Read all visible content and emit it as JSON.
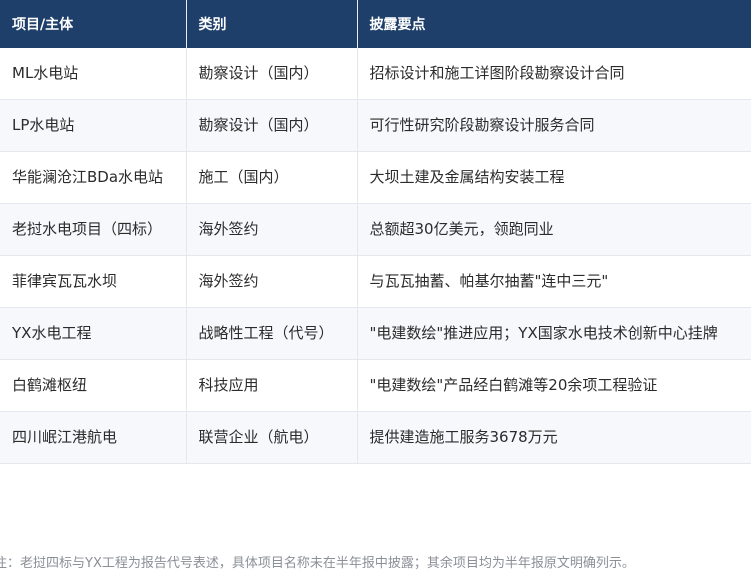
{
  "table": {
    "headers": [
      "项目/主体",
      "类别",
      "披露要点"
    ],
    "rows": [
      [
        "ML水电站",
        "勘察设计（国内）",
        "招标设计和施工详图阶段勘察设计合同"
      ],
      [
        "LP水电站",
        "勘察设计（国内）",
        "可行性研究阶段勘察设计服务合同"
      ],
      [
        "华能澜沧江BDa水电站",
        "施工（国内）",
        "大坝土建及金属结构安装工程"
      ],
      [
        "老挝水电项目（四标）",
        "海外签约",
        "总额超30亿美元，领跑同业"
      ],
      [
        "菲律宾瓦瓦水坝",
        "海外签约",
        "与瓦瓦抽蓄、帕基尔抽蓄\"连中三元\""
      ],
      [
        "YX水电工程",
        "战略性工程（代号）",
        "\"电建数绘\"推进应用；YX国家水电技术创新中心挂牌"
      ],
      [
        "白鹤滩枢纽",
        "科技应用",
        "\"电建数绘\"产品经白鹤滩等20余项工程验证"
      ],
      [
        "四川岷江港航电",
        "联营企业（航电）",
        "提供建造施工服务3678万元"
      ]
    ]
  },
  "note": "注：老挝四标与YX工程为报告代号表述，具体项目名称未在半年报中披露；其余项目均为半年报原文明确列示。"
}
